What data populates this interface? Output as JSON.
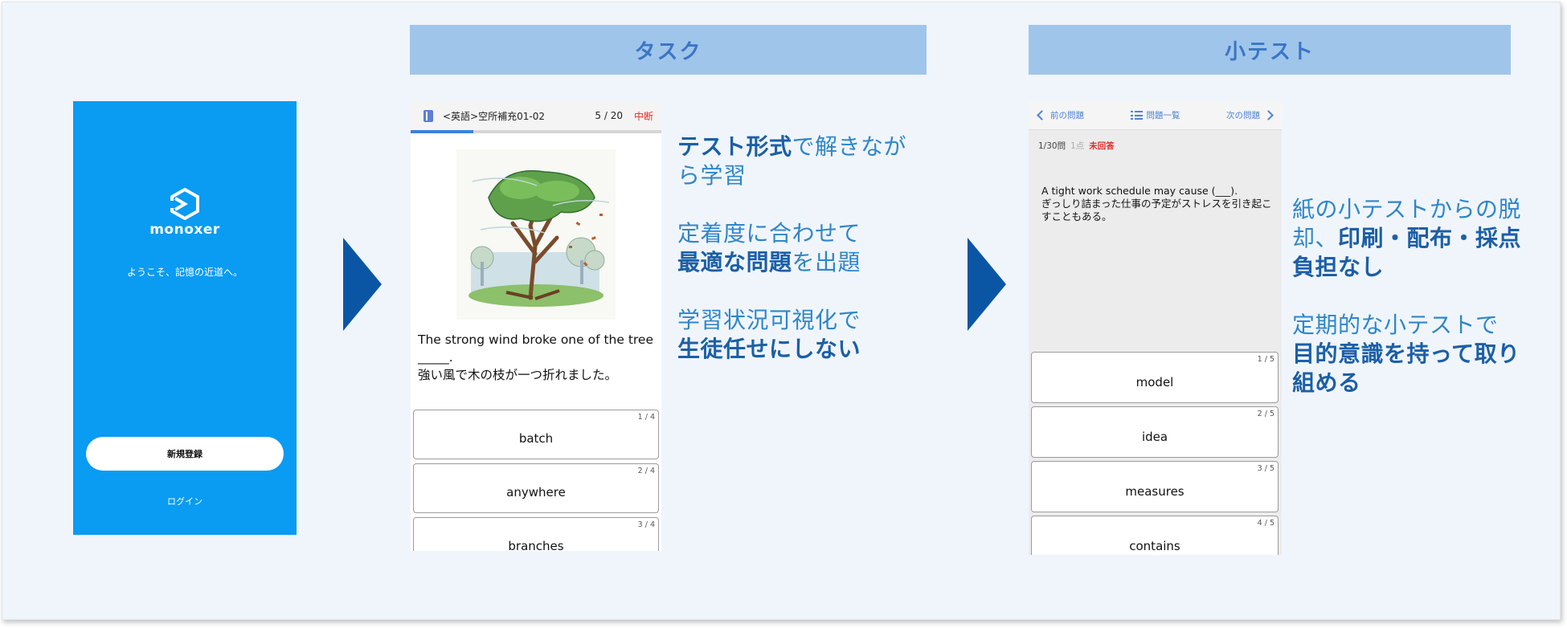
{
  "login": {
    "brand": "monoxer",
    "welcome": "ようこそ、記憶の近道へ。",
    "signup": "新規登録",
    "login": "ログイン"
  },
  "sections": {
    "task_header": "タスク",
    "quiz_header": "小テスト"
  },
  "task_screen": {
    "title": "<英語>空所補充01-02",
    "count": "5 / 20",
    "stop": "中断",
    "progress": 0.25,
    "question_en": "The strong wind broke one of the tree _____.",
    "question_ja": "強い風で木の枝が一つ折れました。",
    "options": [
      {
        "num": "1 / 4",
        "label": "batch"
      },
      {
        "num": "2 / 4",
        "label": "anywhere"
      },
      {
        "num": "3 / 4",
        "label": "branches"
      }
    ]
  },
  "quiz_screen": {
    "prev": "前の問題",
    "list": "問題一覧",
    "next": "次の問題",
    "progress": "1/30問",
    "points": "1点",
    "status": "未回答",
    "question_en": "A tight work schedule may cause (___).",
    "question_ja": "ぎっしり詰まった仕事の予定がストレスを引き起こすこともある。",
    "options": [
      {
        "num": "1 / 5",
        "label": "model"
      },
      {
        "num": "2 / 5",
        "label": "idea"
      },
      {
        "num": "3 / 5",
        "label": "measures"
      },
      {
        "num": "4 / 5",
        "label": "contains"
      }
    ]
  },
  "task_desc": {
    "p1_bold": "テスト形式",
    "p1_rest": "で解きなが",
    "p1_line2": "ら学習",
    "p2_line1": "定着度に合わせて",
    "p2_bold": "最適な問題",
    "p2_rest": "を出題",
    "p3_line1": "学習状況可視化で",
    "p3_bold": "生徒任せにしない"
  },
  "quiz_desc": {
    "p1_line1": "紙の小テストからの脱",
    "p1_l2_plain": "却、",
    "p1_l2_bold": "印刷・配布・採点",
    "p1_line3": "負担なし",
    "p2_line1": "定期的な小テストで",
    "p2_line2": "目的意識を持って取り",
    "p2_line3": "組める"
  },
  "colors": {
    "login_bg": "#0a9bf2",
    "header_bg": "#a0c5ea",
    "header_text": "#3a76c7",
    "arrow": "#0b56a4",
    "desc_text": "#2f86c9",
    "desc_bold": "#1b5fa6",
    "alert": "#e0302a"
  }
}
